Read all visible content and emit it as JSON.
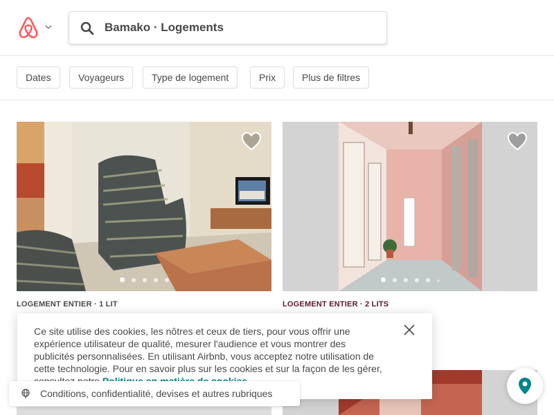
{
  "header": {
    "logo_icon": "airbnb-logo-icon",
    "brand_color": "#ff5a5f",
    "search_text": "Bamako · Logements"
  },
  "filters": {
    "items": [
      {
        "label": "Dates"
      },
      {
        "label": "Voyageurs"
      },
      {
        "label": "Type de logement"
      },
      {
        "label": "Prix"
      },
      {
        "label": "Plus de filtres"
      }
    ]
  },
  "listings": [
    {
      "meta": "LOGEMENT ENTIER · 1 LIT",
      "meta_color": "#484848",
      "photo_count": 5,
      "active_photo": 1
    },
    {
      "meta": "LOGEMENT ENTIER · 2 LITS",
      "meta_color": "#5a1a2a",
      "photo_count": 6,
      "active_photo": 1
    }
  ],
  "cookie_banner": {
    "text": "Ce site utilise des cookies, les nôtres et ceux de tiers, pour vous offrir une expérience utilisateur de qualité, mesurer l'audience et vous montrer des publicités personnalisées. En utilisant Airbnb, vous acceptez notre utilisation de cette technologie. Pour en savoir plus sur les cookies et sur la façon de les gérer, consultez notre",
    "link": "Politique en matière de cookies",
    "link_suffix": ".",
    "link_color": "#008489"
  },
  "footer": {
    "label": "Conditions, confidentialité, devises et autres rubriques"
  },
  "map_button": {
    "icon": "map-pin-icon",
    "color": "#008489"
  }
}
